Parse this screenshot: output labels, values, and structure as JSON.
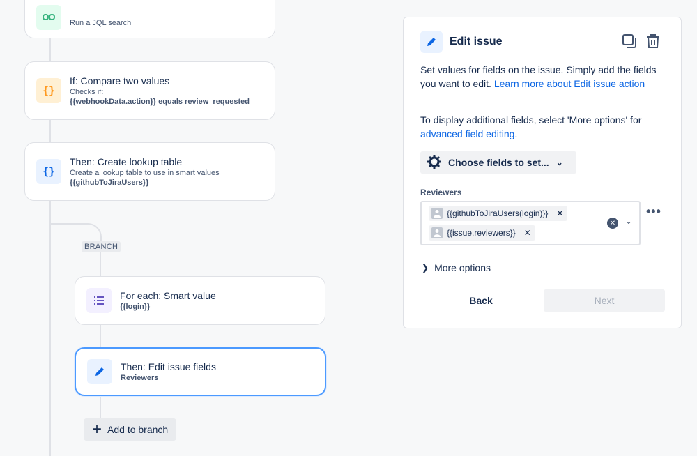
{
  "flow": {
    "cards": [
      {
        "title": "",
        "subtitle": "Run a JQL search",
        "icon": "jql-search-icon"
      },
      {
        "title": "If: Compare two values",
        "subtitle": "Checks if:",
        "detail": "{{webhookData.action}} equals review_requested",
        "icon": "condition-braces-icon"
      },
      {
        "title": "Then: Create lookup table",
        "subtitle": "Create a lookup table to use in smart values",
        "detail": "{{githubToJiraUsers}}",
        "icon": "lookup-braces-icon"
      },
      {
        "title": "For each: Smart value",
        "detail": "{{login}}",
        "icon": "list-icon"
      },
      {
        "title": "Then: Edit issue fields",
        "detail": "Reviewers",
        "icon": "pencil-icon"
      }
    ],
    "branch_label": "BRANCH",
    "add_to_branch": "Add to branch"
  },
  "panel": {
    "title": "Edit issue",
    "intro": "Set values for fields on the issue. Simply add the fields you want to edit.",
    "intro_link": "Learn more about Edit issue action",
    "more_text": "To display additional fields, select 'More options' for",
    "more_link": "advanced field editing",
    "more_text_end": ".",
    "choose_fields": "Choose fields to set...",
    "reviewers_label": "Reviewers",
    "reviewers": [
      {
        "value": "{{githubToJiraUsers(login)}}"
      },
      {
        "value": "{{issue.reviewers}}"
      }
    ],
    "more_options": "More options",
    "back": "Back",
    "next": "Next"
  },
  "colors": {
    "accent": "#0c66e4",
    "selected_border": "#4c9aff",
    "background": "#f7f8f9"
  }
}
